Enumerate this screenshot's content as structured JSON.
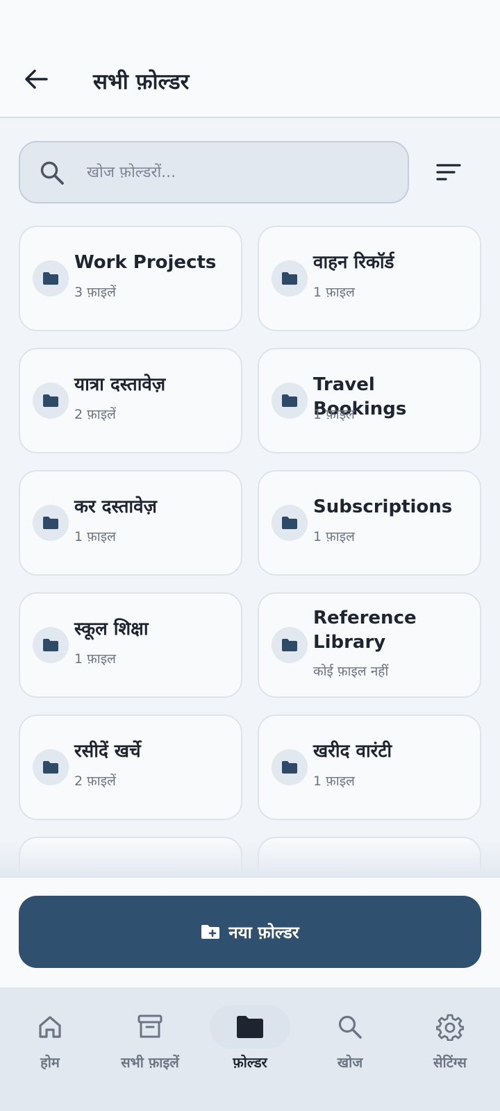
{
  "header": {
    "title": "सभी फ़ोल्डर",
    "back_icon": "arrow-left-icon"
  },
  "search": {
    "placeholder": "खोज फ़ोल्डरों...",
    "value": "",
    "icon": "search-icon",
    "sort_icon": "sort-icon"
  },
  "folders": [
    {
      "name": "Work Projects",
      "count": "3 फ़ाइलें"
    },
    {
      "name": "वाहन रिकॉर्ड",
      "count": "1 फ़ाइल"
    },
    {
      "name": "यात्रा दस्तावेज़",
      "count": "2 फ़ाइलें"
    },
    {
      "name": "Travel Bookings",
      "count": "1 फ़ाइल"
    },
    {
      "name": "कर दस्तावेज़",
      "count": "1 फ़ाइल"
    },
    {
      "name": "Subscriptions",
      "count": "1 फ़ाइल"
    },
    {
      "name": "स्कूल शिक्षा",
      "count": "1 फ़ाइल"
    },
    {
      "name": "Reference Library",
      "count": "कोई फ़ाइल नहीं"
    },
    {
      "name": "रसीदें खर्चे",
      "count": "2 फ़ाइलें"
    },
    {
      "name": "खरीद वारंटी",
      "count": "1 फ़ाइल"
    }
  ],
  "action": {
    "new_folder_label": "नया फ़ोल्डर",
    "icon": "folder-plus-icon"
  },
  "nav": {
    "items": [
      {
        "label": "होम",
        "icon": "home-icon"
      },
      {
        "label": "सभी फ़ाइलें",
        "icon": "archive-icon"
      },
      {
        "label": "फ़ोल्डर",
        "icon": "folder-icon"
      },
      {
        "label": "खोज",
        "icon": "search-icon"
      },
      {
        "label": "सेटिंग्स",
        "icon": "gear-icon"
      }
    ],
    "active": "फ़ोल्डर"
  },
  "colors": {
    "primary": "#30506f",
    "folder_icon": "#2d4a68",
    "background": "#f1f5f9"
  }
}
